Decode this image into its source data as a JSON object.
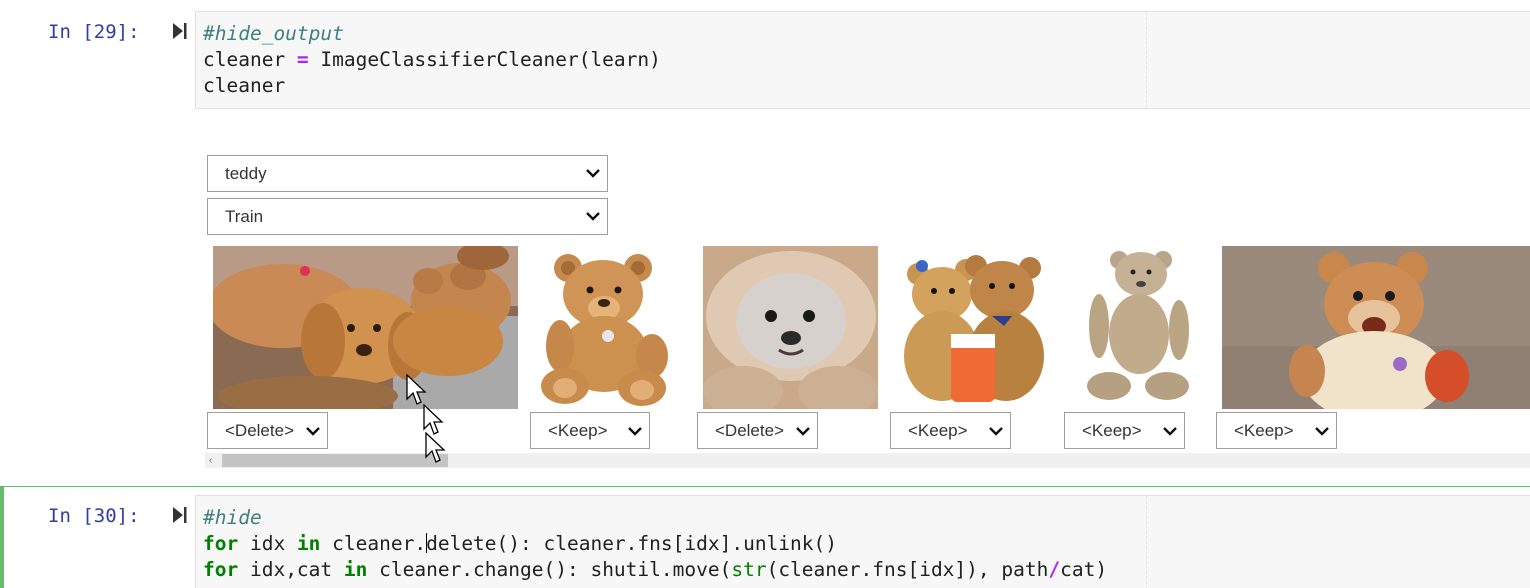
{
  "cells": [
    {
      "prompt": "In [29]:",
      "code_tokens": [
        [
          {
            "t": "#hide_output",
            "c": "comment"
          }
        ],
        [
          {
            "t": "cleaner ",
            "c": ""
          },
          {
            "t": "=",
            "c": "op"
          },
          {
            "t": " ImageClassifierCleaner(learn)",
            "c": ""
          }
        ],
        [
          {
            "t": "cleaner",
            "c": ""
          }
        ]
      ]
    },
    {
      "prompt": "In [30]:",
      "code_tokens": [
        [
          {
            "t": "#hide",
            "c": "comment"
          }
        ],
        [
          {
            "t": "for",
            "c": "kw"
          },
          {
            "t": " idx ",
            "c": ""
          },
          {
            "t": "in",
            "c": "kw"
          },
          {
            "t": " cleaner.",
            "c": ""
          },
          {
            "t": "",
            "c": "cursor"
          },
          {
            "t": "delete(): cleaner.fns[idx].unlink()",
            "c": ""
          }
        ],
        [
          {
            "t": "for",
            "c": "kw"
          },
          {
            "t": " idx,cat ",
            "c": ""
          },
          {
            "t": "in",
            "c": "kw"
          },
          {
            "t": " cleaner.change(): shutil.move(",
            "c": ""
          },
          {
            "t": "str",
            "c": "builtin"
          },
          {
            "t": "(cleaner.fns[idx]), path",
            "c": ""
          },
          {
            "t": "/",
            "c": "op"
          },
          {
            "t": "cat)",
            "c": ""
          }
        ]
      ]
    }
  ],
  "widget": {
    "category_select": "teddy",
    "split_select": "Train",
    "images": [
      {
        "subject": "golden puppies",
        "action": "<Delete>"
      },
      {
        "subject": "teddy bear",
        "action": "<Keep>"
      },
      {
        "subject": "fluffy dog",
        "action": "<Delete>"
      },
      {
        "subject": "two teddy bears with drink",
        "action": "<Keep>"
      },
      {
        "subject": "vintage teddy bear",
        "action": "<Keep>"
      },
      {
        "subject": "teddy ruxpin bear",
        "action": "<Keep>"
      }
    ]
  },
  "colors": {
    "prompt": "#303f9f",
    "comment": "#408080",
    "keyword": "#008000",
    "operator": "#aa22ff",
    "selected_cell_border": "#66bb6a"
  }
}
